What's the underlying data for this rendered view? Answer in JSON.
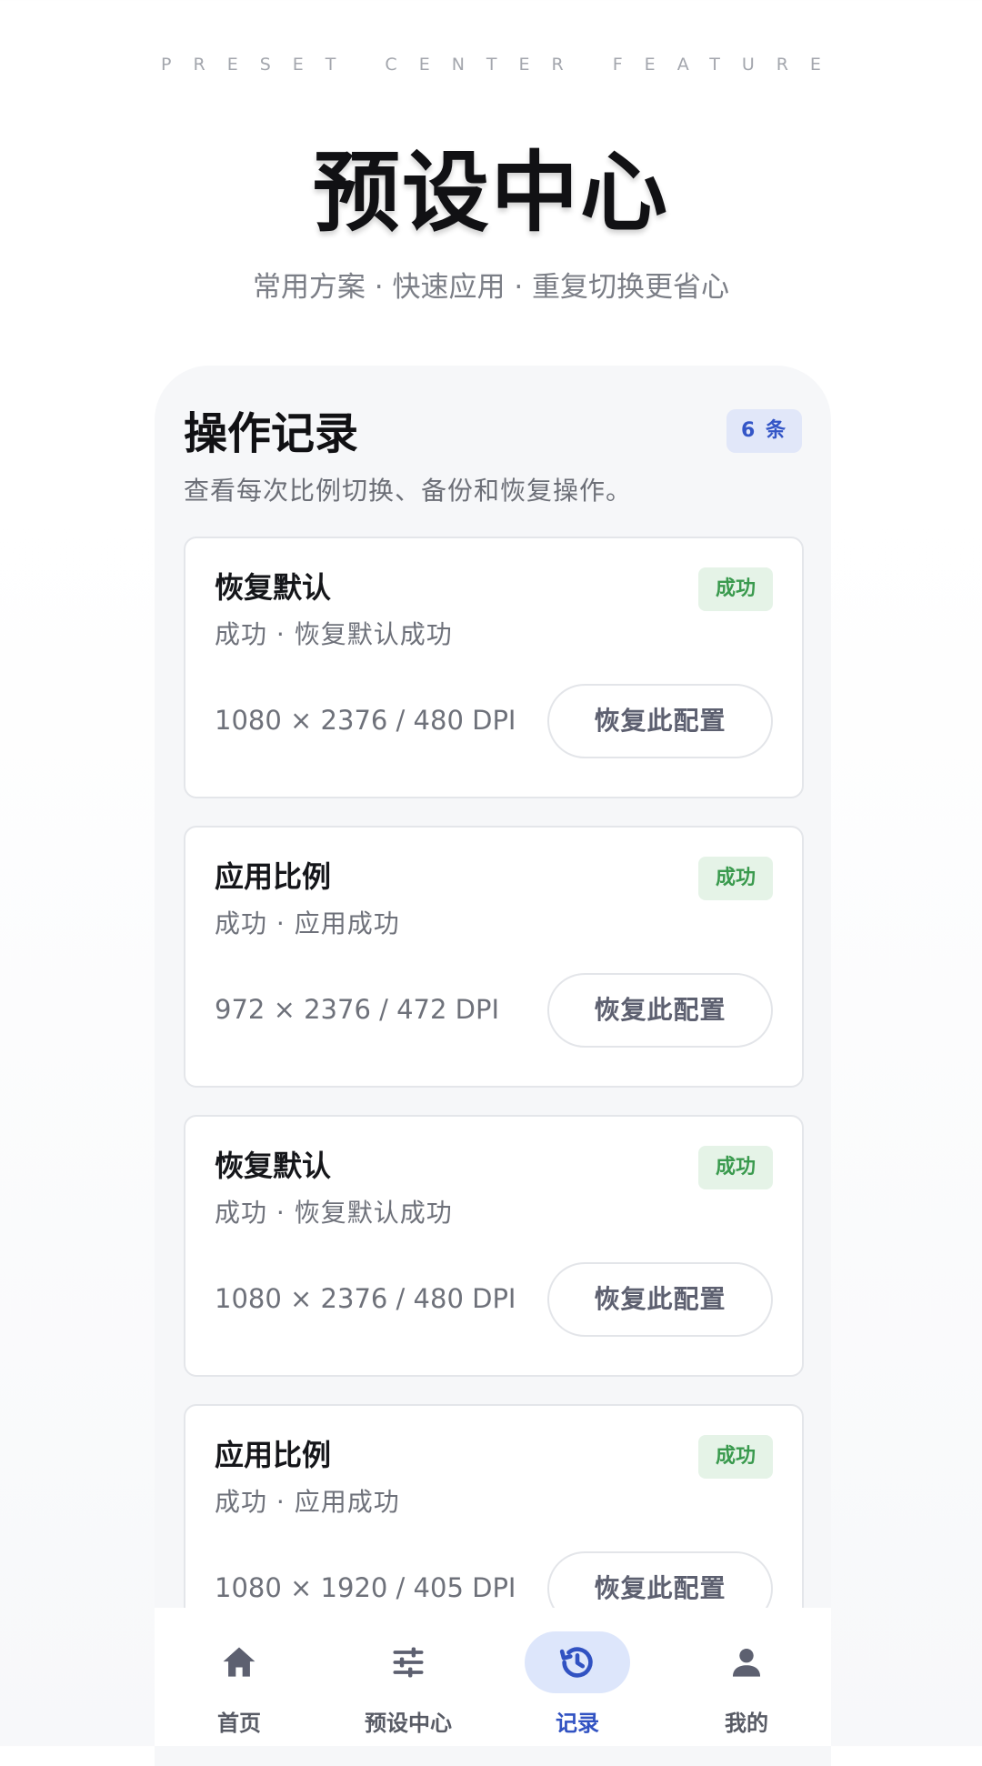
{
  "header": {
    "eyebrow": "PRESET CENTER FEATURE",
    "title": "预设中心",
    "subtitle": "常用方案 · 快速应用 · 重复切换更省心"
  },
  "panel": {
    "title": "操作记录",
    "count_badge": "6 条",
    "description": "查看每次比例切换、备份和恢复操作。"
  },
  "records": [
    {
      "title": "恢复默认",
      "status": "成功",
      "detail": "成功 · 恢复默认成功",
      "spec": "1080 × 2376 / 480 DPI",
      "action": "恢复此配置"
    },
    {
      "title": "应用比例",
      "status": "成功",
      "detail": "成功 · 应用成功",
      "spec": "972 × 2376 / 472 DPI",
      "action": "恢复此配置"
    },
    {
      "title": "恢复默认",
      "status": "成功",
      "detail": "成功 · 恢复默认成功",
      "spec": "1080 × 2376 / 480 DPI",
      "action": "恢复此配置"
    },
    {
      "title": "应用比例",
      "status": "成功",
      "detail": "成功 · 应用成功",
      "spec": "1080 × 1920 / 405 DPI",
      "action": "恢复此配置"
    }
  ],
  "bottom_nav": {
    "items": [
      {
        "label": "首页",
        "icon": "home-icon"
      },
      {
        "label": "预设中心",
        "icon": "sliders-icon"
      },
      {
        "label": "记录",
        "icon": "history-icon",
        "active": true
      },
      {
        "label": "我的",
        "icon": "person-icon"
      }
    ]
  },
  "colors": {
    "accent": "#3152c2",
    "success": "#3a9a4e",
    "success_bg": "#e5f3e7",
    "badge_bg": "#e1e7f9"
  }
}
